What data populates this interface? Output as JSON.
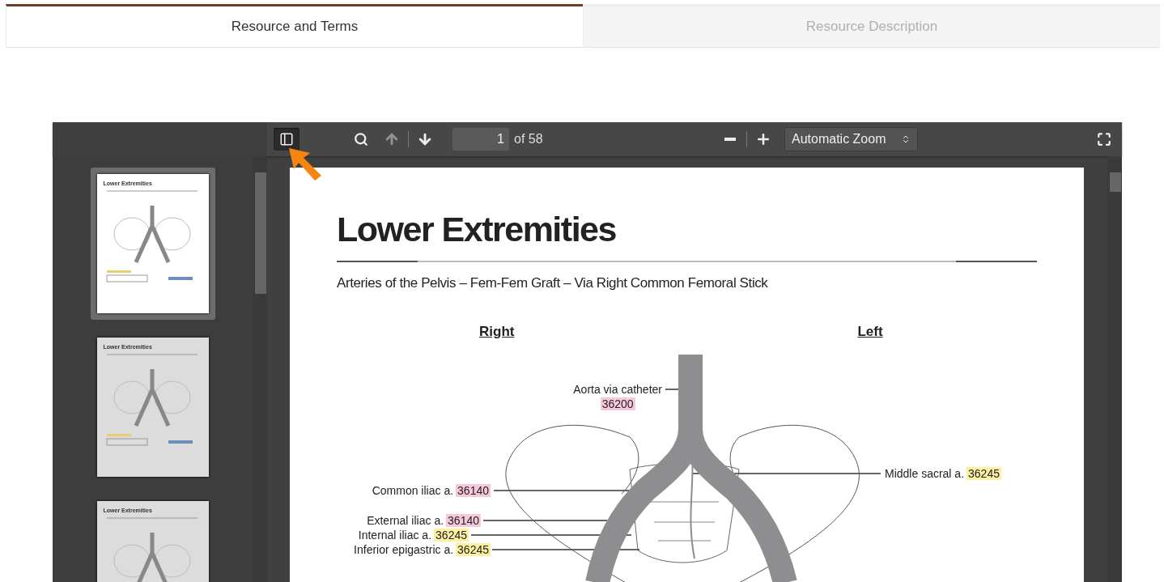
{
  "tabs": [
    {
      "label": "Resource and Terms",
      "selected": true
    },
    {
      "label": "Resource Description",
      "selected": false
    }
  ],
  "toolbar": {
    "sidebar_toggle_on": true,
    "previous_disabled": true,
    "page_number": "1",
    "page_count": "of 58",
    "zoom": "Automatic Zoom"
  },
  "thumbnails": [
    {
      "title": "Lower Extremities",
      "selected": true
    },
    {
      "title": "Lower Extremities",
      "selected": false
    },
    {
      "title": "Lower Extremities",
      "selected": false
    }
  ],
  "document": {
    "title": "Lower Extremities",
    "subtitle": "Arteries of the Pelvis – Fem-Fem Graft – Via Right Common Femoral Stick",
    "columns": [
      "Right",
      "Left"
    ],
    "labels": [
      {
        "kind": "stacked",
        "name": "Aorta via catheter",
        "code": "36200",
        "color": "#f7c8dc"
      },
      {
        "kind": "inline",
        "name": "Middle sacral a.",
        "code": "36245",
        "color": "#fdf0a0"
      },
      {
        "kind": "inline",
        "name": "Common iliac a.",
        "code": "36140",
        "color": "#f7c8dc"
      },
      {
        "kind": "inline",
        "name": "External iliac a.",
        "code": "36140",
        "color": "#f7c8dc"
      },
      {
        "kind": "inline",
        "name": "Internal iliac a.",
        "code": "36245",
        "color": "#fdf0a0"
      },
      {
        "kind": "inline",
        "name": "Inferior epigastric a.",
        "code": "36245",
        "color": "#fdf0a0"
      }
    ]
  }
}
